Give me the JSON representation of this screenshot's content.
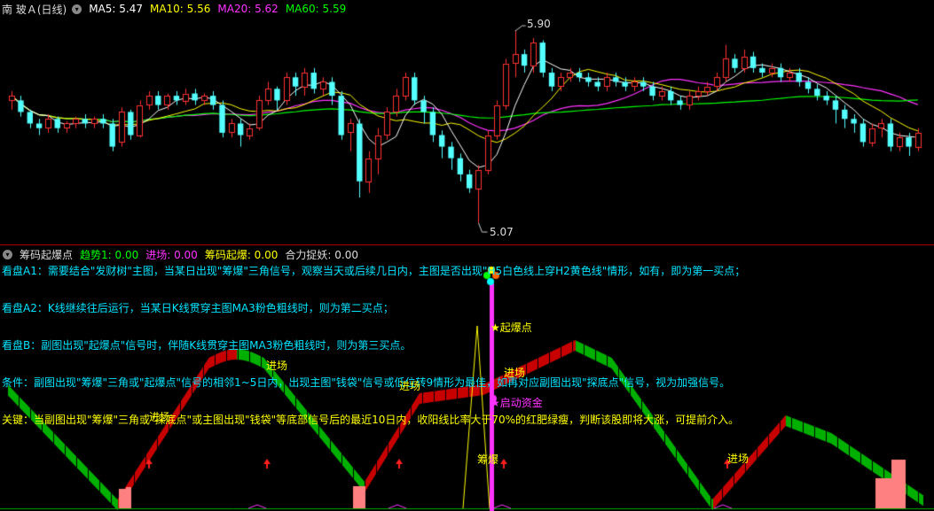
{
  "main_header": {
    "title": "南 玻Ａ(日线)",
    "ma5": "MA5: 5.47",
    "ma10": "MA10: 5.56",
    "ma20": "MA20: 5.62",
    "ma60": "MA60: 5.59",
    "colors": {
      "ma5": "#ffffff",
      "ma10": "#ffff00",
      "ma20": "#ff33ff",
      "ma60": "#00ff00"
    }
  },
  "main_annotations": {
    "high": "5.90",
    "low": "5.07"
  },
  "sub_header": {
    "title": "筹码起爆点",
    "trend": "趋势1: 0.00",
    "entry": "进场: 0.00",
    "chip": "筹码起爆: 0.00",
    "force": "合力捉妖: 0.00"
  },
  "descriptions": [
    "看盘A1：需要结合\"发财树\"主图，当某日出现\"筹爆\"三角信号，观察当天或后续几日内，主图是否出现\"H5白色线上穿H2黄色线\"情形，如有，即为第一买点；",
    "看盘A2：K线继续往后运行，当某日K线贯穿主图MA3粉色粗线时，则为第二买点；",
    "看盘B：副图出现\"起爆点\"信号时，伴随K线贯穿主图MA3粉色粗线时，则为第三买点。",
    "条件：副图出现\"筹爆\"三角或\"起爆点\"信号的相邻1~5日内，出现主图\"钱袋\"信号或低位转9情形为最佳，如再对应副图出现\"探底点\"信号，视为加强信号。",
    "关键：当副图出现\"筹爆\"三角或\"探底点\"或主图出现\"钱袋\"等底部信号后的最近10日内，收阳线比率大于70%的红肥绿瘦，判断该股即将大涨，可提前介入。"
  ],
  "sub_labels": {
    "entry": "进场",
    "qibao": "★起爆点",
    "qidong": "★启动资金",
    "choubao": "筹爆"
  },
  "chart_data": {
    "type": "candlestick",
    "y_range": [
      5.0,
      5.95
    ],
    "candles": [
      [
        5.6,
        5.62,
        5.56,
        5.64
      ],
      [
        5.6,
        5.55,
        5.53,
        5.62
      ],
      [
        5.55,
        5.5,
        5.48,
        5.56
      ],
      [
        5.5,
        5.48,
        5.45,
        5.52
      ],
      [
        5.48,
        5.52,
        5.46,
        5.54
      ],
      [
        5.52,
        5.48,
        5.46,
        5.53
      ],
      [
        5.48,
        5.5,
        5.46,
        5.51
      ],
      [
        5.5,
        5.52,
        5.48,
        5.53
      ],
      [
        5.52,
        5.5,
        5.48,
        5.54
      ],
      [
        5.5,
        5.52,
        5.48,
        5.53
      ],
      [
        5.52,
        5.5,
        5.48,
        5.54
      ],
      [
        5.5,
        5.4,
        5.38,
        5.52
      ],
      [
        5.42,
        5.55,
        5.4,
        5.57
      ],
      [
        5.55,
        5.45,
        5.43,
        5.56
      ],
      [
        5.45,
        5.58,
        5.44,
        5.6
      ],
      [
        5.58,
        5.62,
        5.56,
        5.64
      ],
      [
        5.62,
        5.58,
        5.56,
        5.64
      ],
      [
        5.58,
        5.62,
        5.56,
        5.63
      ],
      [
        5.62,
        5.6,
        5.58,
        5.64
      ],
      [
        5.6,
        5.63,
        5.58,
        5.65
      ],
      [
        5.63,
        5.6,
        5.58,
        5.65
      ],
      [
        5.6,
        5.62,
        5.58,
        5.63
      ],
      [
        5.62,
        5.58,
        5.56,
        5.64
      ],
      [
        5.58,
        5.46,
        5.44,
        5.6
      ],
      [
        5.46,
        5.5,
        5.44,
        5.52
      ],
      [
        5.5,
        5.45,
        5.4,
        5.52
      ],
      [
        5.45,
        5.48,
        5.43,
        5.5
      ],
      [
        5.48,
        5.6,
        5.47,
        5.62
      ],
      [
        5.6,
        5.65,
        5.58,
        5.68
      ],
      [
        5.65,
        5.6,
        5.56,
        5.66
      ],
      [
        5.6,
        5.7,
        5.58,
        5.72
      ],
      [
        5.7,
        5.66,
        5.62,
        5.72
      ],
      [
        5.66,
        5.72,
        5.62,
        5.74
      ],
      [
        5.72,
        5.65,
        5.63,
        5.74
      ],
      [
        5.65,
        5.68,
        5.62,
        5.7
      ],
      [
        5.68,
        5.62,
        5.58,
        5.7
      ],
      [
        5.62,
        5.45,
        5.43,
        5.64
      ],
      [
        5.46,
        5.5,
        5.38,
        5.52
      ],
      [
        5.5,
        5.25,
        5.18,
        5.52
      ],
      [
        5.25,
        5.35,
        5.2,
        5.38
      ],
      [
        5.35,
        5.45,
        5.28,
        5.48
      ],
      [
        5.45,
        5.55,
        5.43,
        5.57
      ],
      [
        5.55,
        5.62,
        5.53,
        5.65
      ],
      [
        5.62,
        5.7,
        5.6,
        5.72
      ],
      [
        5.7,
        5.6,
        5.58,
        5.72
      ],
      [
        5.6,
        5.55,
        5.5,
        5.62
      ],
      [
        5.55,
        5.45,
        5.42,
        5.57
      ],
      [
        5.45,
        5.4,
        5.35,
        5.47
      ],
      [
        5.4,
        5.35,
        5.3,
        5.42
      ],
      [
        5.35,
        5.28,
        5.25,
        5.37
      ],
      [
        5.28,
        5.22,
        5.2,
        5.3
      ],
      [
        5.22,
        5.3,
        5.07,
        5.32
      ],
      [
        5.3,
        5.45,
        5.28,
        5.47
      ],
      [
        5.45,
        5.58,
        5.43,
        5.6
      ],
      [
        5.58,
        5.76,
        5.56,
        5.78
      ],
      [
        5.76,
        5.8,
        5.7,
        5.9
      ],
      [
        5.8,
        5.75,
        5.72,
        5.82
      ],
      [
        5.75,
        5.85,
        5.72,
        5.87
      ],
      [
        5.85,
        5.72,
        5.7,
        5.86
      ],
      [
        5.72,
        5.66,
        5.64,
        5.74
      ],
      [
        5.66,
        5.7,
        5.64,
        5.72
      ],
      [
        5.7,
        5.72,
        5.68,
        5.74
      ],
      [
        5.72,
        5.7,
        5.68,
        5.74
      ],
      [
        5.7,
        5.68,
        5.66,
        5.72
      ],
      [
        5.68,
        5.66,
        5.64,
        5.7
      ],
      [
        5.66,
        5.7,
        5.64,
        5.72
      ],
      [
        5.7,
        5.68,
        5.66,
        5.72
      ],
      [
        5.68,
        5.66,
        5.64,
        5.7
      ],
      [
        5.66,
        5.68,
        5.64,
        5.7
      ],
      [
        5.68,
        5.66,
        5.64,
        5.7
      ],
      [
        5.66,
        5.62,
        5.6,
        5.68
      ],
      [
        5.62,
        5.64,
        5.6,
        5.66
      ],
      [
        5.64,
        5.6,
        5.58,
        5.66
      ],
      [
        5.6,
        5.58,
        5.56,
        5.62
      ],
      [
        5.58,
        5.62,
        5.56,
        5.64
      ],
      [
        5.62,
        5.64,
        5.6,
        5.66
      ],
      [
        5.64,
        5.66,
        5.62,
        5.68
      ],
      [
        5.66,
        5.7,
        5.64,
        5.72
      ],
      [
        5.7,
        5.78,
        5.68,
        5.84
      ],
      [
        5.78,
        5.74,
        5.72,
        5.8
      ],
      [
        5.74,
        5.79,
        5.72,
        5.82
      ],
      [
        5.79,
        5.74,
        5.72,
        5.81
      ],
      [
        5.74,
        5.72,
        5.7,
        5.76
      ],
      [
        5.72,
        5.74,
        5.7,
        5.76
      ],
      [
        5.74,
        5.7,
        5.68,
        5.76
      ],
      [
        5.7,
        5.72,
        5.68,
        5.74
      ],
      [
        5.72,
        5.68,
        5.66,
        5.74
      ],
      [
        5.68,
        5.65,
        5.63,
        5.7
      ],
      [
        5.65,
        5.62,
        5.6,
        5.67
      ],
      [
        5.62,
        5.6,
        5.58,
        5.64
      ],
      [
        5.6,
        5.56,
        5.5,
        5.62
      ],
      [
        5.56,
        5.52,
        5.48,
        5.58
      ],
      [
        5.52,
        5.5,
        5.46,
        5.54
      ],
      [
        5.5,
        5.42,
        5.4,
        5.52
      ],
      [
        5.42,
        5.48,
        5.4,
        5.5
      ],
      [
        5.48,
        5.5,
        5.44,
        5.52
      ],
      [
        5.5,
        5.4,
        5.38,
        5.52
      ],
      [
        5.4,
        5.44,
        5.38,
        5.46
      ],
      [
        5.44,
        5.4,
        5.36,
        5.46
      ],
      [
        5.4,
        5.46,
        5.38,
        5.48
      ]
    ]
  }
}
